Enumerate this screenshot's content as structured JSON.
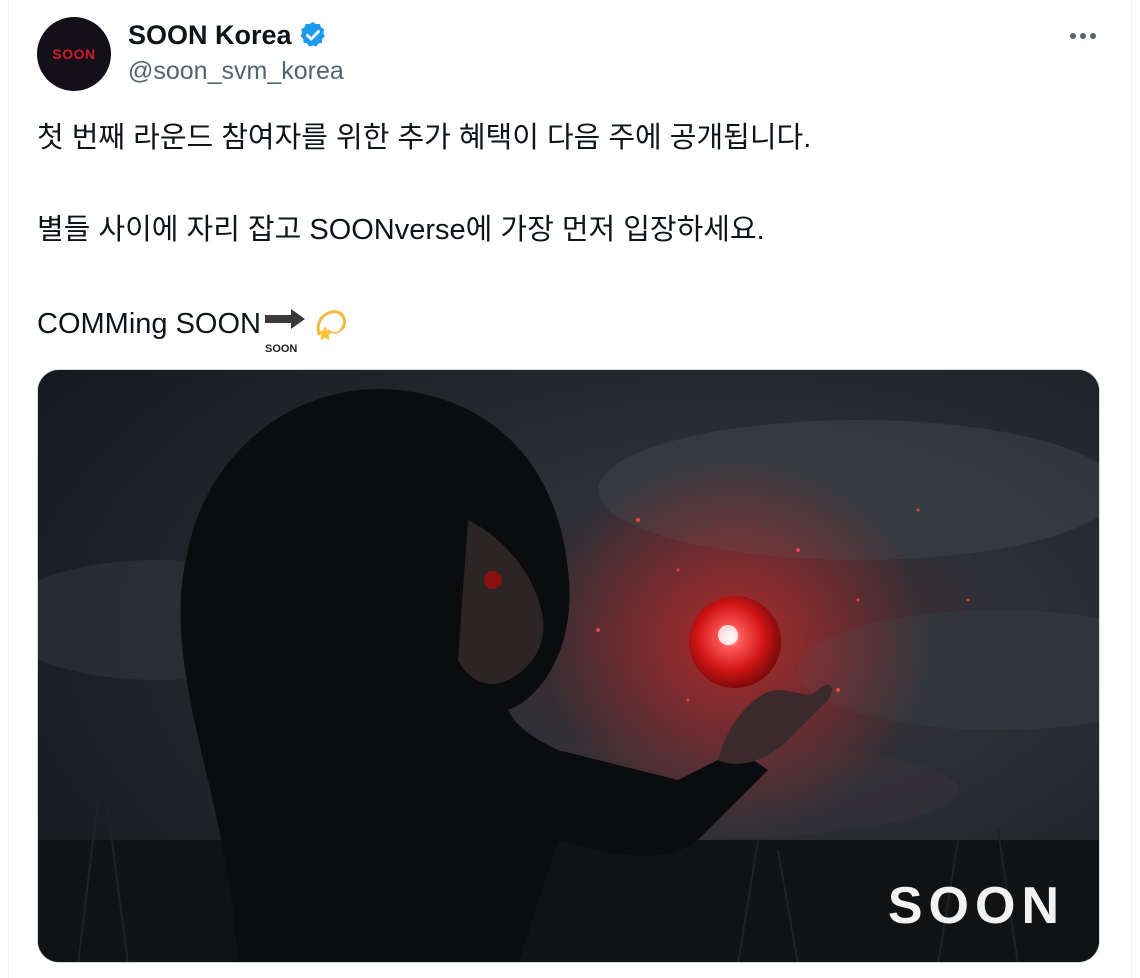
{
  "author": {
    "avatar_text": "SOON",
    "display_name": "SOON Korea",
    "handle": "@soon_svm_korea",
    "verified_icon": "verified-badge-icon",
    "verified_color": "#1d9bf0"
  },
  "menu": {
    "more_icon": "more-dots-icon"
  },
  "tweet": {
    "line1": "첫 번째 라운드 참여자를 위한 추가 혜택이 다음 주에 공개됩니다.",
    "line2": "별들 사이에 자리 잡고 SOONverse에 가장 먼저 입장하세요.",
    "line3": "COMMing SOON",
    "soon_emoji_label": "SOON",
    "dizzy_icon": "dizzy-star-icon"
  },
  "media": {
    "wordmark": "SOON",
    "orb_color": "#e02020"
  }
}
